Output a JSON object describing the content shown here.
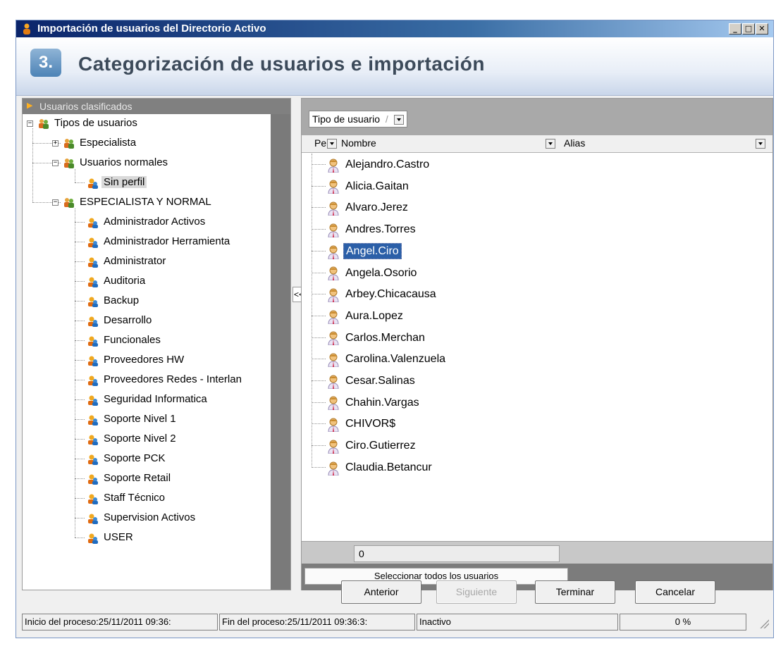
{
  "window": {
    "title": "Importación de usuarios del Directorio Activo",
    "controls": [
      "minimize-icon",
      "maximize-icon",
      "close-icon"
    ]
  },
  "header": {
    "step_number": "3.",
    "title": "Categorización de usuarios e importación"
  },
  "left_panel": {
    "title": "Usuarios clasificados",
    "collapse_label": "<<",
    "tree": {
      "root": "Tipos de usuarios",
      "groups": [
        {
          "label": "Especialista",
          "expanded": false
        },
        {
          "label": "Usuarios normales",
          "expanded": true,
          "children": [
            "Sin perfil"
          ]
        },
        {
          "label": "ESPECIALISTA Y NORMAL",
          "expanded": true,
          "children": [
            "Administrador Activos",
            "Administrador Herramienta",
            "Administrator",
            "Auditoria",
            "Backup",
            "Desarrollo",
            "Funcionales",
            "Proveedores HW",
            "Proveedores Redes - Interlan",
            "Seguridad Informatica",
            "Soporte Nivel 1",
            "Soporte Nivel 2",
            "Soporte PCK",
            "Soporte Retail",
            "Staff Técnico",
            "Supervision Activos",
            "USER"
          ]
        }
      ],
      "selected": "Sin perfil"
    }
  },
  "right_panel": {
    "group_by_label": "Tipo de usuario",
    "columns": [
      "Pe",
      "Nombre",
      "Alias"
    ],
    "users": [
      "Alejandro.Castro",
      "Alicia.Gaitan",
      "Alvaro.Jerez",
      "Andres.Torres",
      "Angel.Ciro",
      "Angela.Osorio",
      "Arbey.Chicacausa",
      "Aura.Lopez",
      "Carlos.Merchan",
      "Carolina.Valenzuela",
      "Cesar.Salinas",
      "Chahin.Vargas",
      "CHIVOR$",
      "Ciro.Gutierrez",
      "Claudia.Betancur"
    ],
    "selected_user": "Angel.Ciro",
    "footer_count": "0",
    "select_all_label": "Seleccionar todos los usuarios"
  },
  "buttons": {
    "previous": "Anterior",
    "next": "Siguiente",
    "finish": "Terminar",
    "cancel": "Cancelar"
  },
  "status": {
    "start": "Inicio del proceso:25/11/2011 09:36:",
    "end": "Fin del proceso:25/11/2011 09:36:3:",
    "state": "Inactivo",
    "progress": "0 %"
  },
  "colors": {
    "title_bar": "#0a246a",
    "selection": "#2b5fa8",
    "header_text": "#3c4a5a"
  }
}
